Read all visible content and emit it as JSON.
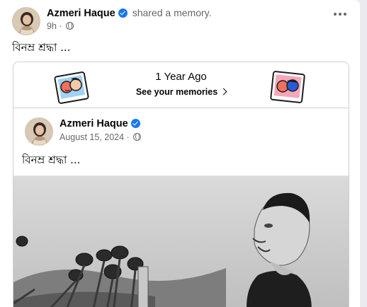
{
  "post": {
    "author": "Azmeri Haque",
    "action": "shared a memory.",
    "time": "9h",
    "text": "বিনম্র শ্রদ্ধা ...",
    "more_label": "More options"
  },
  "memory": {
    "title": "1 Year Ago",
    "link": "See your memories"
  },
  "original_post": {
    "author": "Azmeri Haque",
    "date": "August 15, 2024",
    "text": "বিনম্র শ্রদ্ধা ..."
  },
  "icons": {
    "verified": "verified-badge-icon",
    "privacy": "globe-icon",
    "more": "more-options-icon",
    "chevron": "chevron-right-icon"
  },
  "colors": {
    "verified_blue": "#1877f2",
    "secondary_text": "#65676b",
    "border": "#ced0d4"
  }
}
